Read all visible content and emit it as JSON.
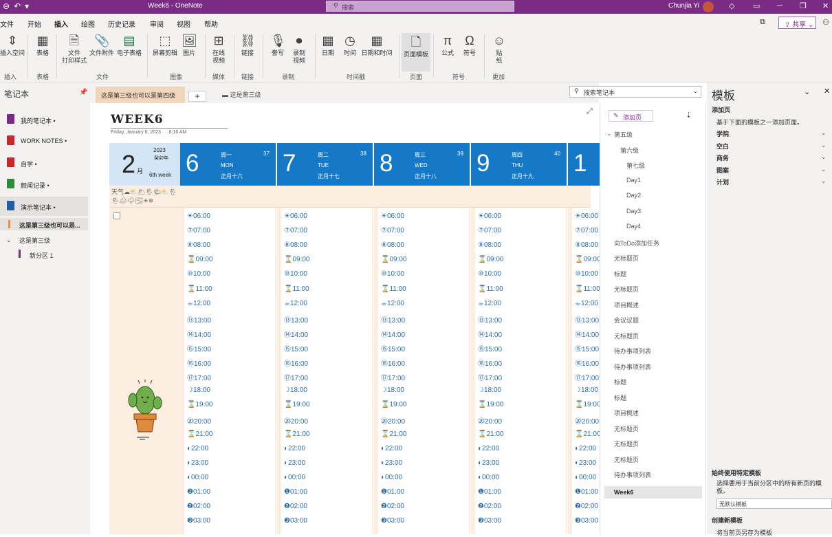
{
  "app": {
    "window_title": "Week6 - OneNote",
    "search_placeholder": "搜索",
    "user_name": "Chunjia Yi",
    "share_label": "共享"
  },
  "menu": [
    "文件",
    "开始",
    "插入",
    "绘图",
    "历史记录",
    "审阅",
    "视图",
    "帮助"
  ],
  "ribbon": {
    "buttons": [
      {
        "label": "插入空间",
        "icon": "insert-space-icon"
      },
      {
        "label": "表格",
        "icon": "table-icon"
      },
      {
        "label": "文件\n打印样式",
        "icon": "file-printout-icon"
      },
      {
        "label": "文件附件",
        "icon": "file-attachment-icon"
      },
      {
        "label": "电子表格",
        "icon": "spreadsheet-icon"
      },
      {
        "label": "屏幕剪辑",
        "icon": "screen-clip-icon"
      },
      {
        "label": "图片",
        "icon": "picture-icon"
      },
      {
        "label": "在线\n视频",
        "icon": "online-video-icon"
      },
      {
        "label": "链接",
        "icon": "link-icon"
      },
      {
        "label": "誊写",
        "icon": "transcribe-icon"
      },
      {
        "label": "录制\n视频",
        "icon": "record-video-icon"
      },
      {
        "label": "日期",
        "icon": "date-icon"
      },
      {
        "label": "时间",
        "icon": "time-icon"
      },
      {
        "label": "日期和时间",
        "icon": "date-time-icon"
      },
      {
        "label": "页面模板",
        "icon": "page-template-icon"
      },
      {
        "label": "公式",
        "icon": "equation-icon"
      },
      {
        "label": "符号",
        "icon": "symbol-icon"
      },
      {
        "label": "贴\n纸",
        "icon": "sticker-icon"
      }
    ],
    "groups": [
      "插入",
      "表格",
      "文件",
      "图像",
      "媒体",
      "链接",
      "录制",
      "时间戳",
      "页面",
      "符号",
      "更加"
    ]
  },
  "notebooks": {
    "header": "笔记本",
    "items": [
      {
        "label": "我的笔记本",
        "color": "#7a2c85"
      },
      {
        "label": "WORK NOTES",
        "color": "#c8282e"
      },
      {
        "label": "自学",
        "color": "#c8282e"
      },
      {
        "label": "颜闻记录",
        "color": "#2e8b3a"
      },
      {
        "label": "演示笔记本",
        "color": "#1f5fa8"
      }
    ],
    "sections": [
      {
        "label": "这是第三级也可以是..."
      },
      {
        "label": "这是第三级"
      },
      {
        "label": "新分区 1"
      }
    ]
  },
  "tabs": {
    "active": "这是第三级也可以是第四级",
    "add": "+",
    "other": "这是第三级"
  },
  "page": {
    "title": "WEEK6",
    "date": "Friday, January 6, 2023",
    "time": "8:16 AM",
    "planner": {
      "year": "2023",
      "cn_year": "癸卯年",
      "month": "2",
      "month_suffix": "月",
      "week_label": "6th week",
      "weather_label": "天气",
      "weather_icons": "☁⛅🌥🌦🌤⛅🌦\n🌦🌧🌩🌫☀❄",
      "days": [
        {
          "num": "6",
          "cn": "周一",
          "en": "MON",
          "lunar": "正月十六",
          "week_no": "37"
        },
        {
          "num": "7",
          "cn": "周二",
          "en": "TUE",
          "lunar": "正月十七",
          "week_no": "38"
        },
        {
          "num": "8",
          "cn": "周三",
          "en": "WED",
          "lunar": "正月十八",
          "week_no": "39"
        },
        {
          "num": "9",
          "cn": "周四",
          "en": "THU",
          "lunar": "正月十九",
          "week_no": "40"
        },
        {
          "num": "1",
          "cn": "",
          "en": "",
          "lunar": "",
          "week_no": ""
        }
      ],
      "times": [
        "06:00",
        "07:00",
        "08:00",
        "09:00",
        "10:00",
        "11:00",
        "12:00",
        "13:00",
        "14:00",
        "15:00",
        "16:00",
        "17:00",
        "18:00",
        "19:00",
        "20:00",
        "21:00",
        "22:00",
        "23:00",
        "00:00",
        "01:00",
        "02:00",
        "03:00"
      ],
      "time_icons": [
        "☀",
        "⑦",
        "⑧",
        "⌛",
        "⑩",
        "⌛",
        "☕",
        "⑬",
        "⑭",
        "⑮",
        "⑯",
        "⑰",
        "☽",
        "⌛",
        "⑳",
        "⌛",
        "◐",
        "◐",
        "◐",
        "❶",
        "❷",
        "❸"
      ]
    }
  },
  "nav": {
    "search_placeholder": "搜索笔记本",
    "add_page": "添加页",
    "pages": [
      {
        "label": "第五级",
        "level": 0,
        "chevron": true
      },
      {
        "label": "第六级",
        "level": 1
      },
      {
        "label": "第七级",
        "level": 2
      },
      {
        "label": "Day1",
        "level": 2
      },
      {
        "label": "Day2",
        "level": 2
      },
      {
        "label": "Day3",
        "level": 2
      },
      {
        "label": "Day4",
        "level": 2
      },
      {
        "label": "向ToDo添加任务",
        "level": 0
      },
      {
        "label": "无标题页",
        "level": 0
      },
      {
        "label": "标题",
        "level": 0
      },
      {
        "label": "无标题页",
        "level": 0
      },
      {
        "label": "项目概述",
        "level": 0
      },
      {
        "label": "会议议题",
        "level": 0
      },
      {
        "label": "无标题页",
        "level": 0
      },
      {
        "label": "待办事项列表",
        "level": 0
      },
      {
        "label": "待办事项列表",
        "level": 0
      },
      {
        "label": "标题",
        "level": 0
      },
      {
        "label": "标题",
        "level": 0
      },
      {
        "label": "项目概述",
        "level": 0
      },
      {
        "label": "无标题页",
        "level": 0
      },
      {
        "label": "无标题页",
        "level": 0
      },
      {
        "label": "无标题页",
        "level": 0
      },
      {
        "label": "待办事项列表",
        "level": 0
      },
      {
        "label": "Week6",
        "level": 0,
        "selected": true
      }
    ]
  },
  "templates": {
    "title": "模板",
    "add_page": "添加页",
    "desc": "基于下面的模板之一添加页面。",
    "categories": [
      "学院",
      "空白",
      "商务",
      "图案",
      "计划"
    ],
    "always_use": "始终使用特定模板",
    "always_desc": "选择要用于当前分区中的所有新页的模板。",
    "default_option": "无默认模板",
    "create_new": "创建新模板",
    "save_as": "将当前页另存为模板"
  }
}
